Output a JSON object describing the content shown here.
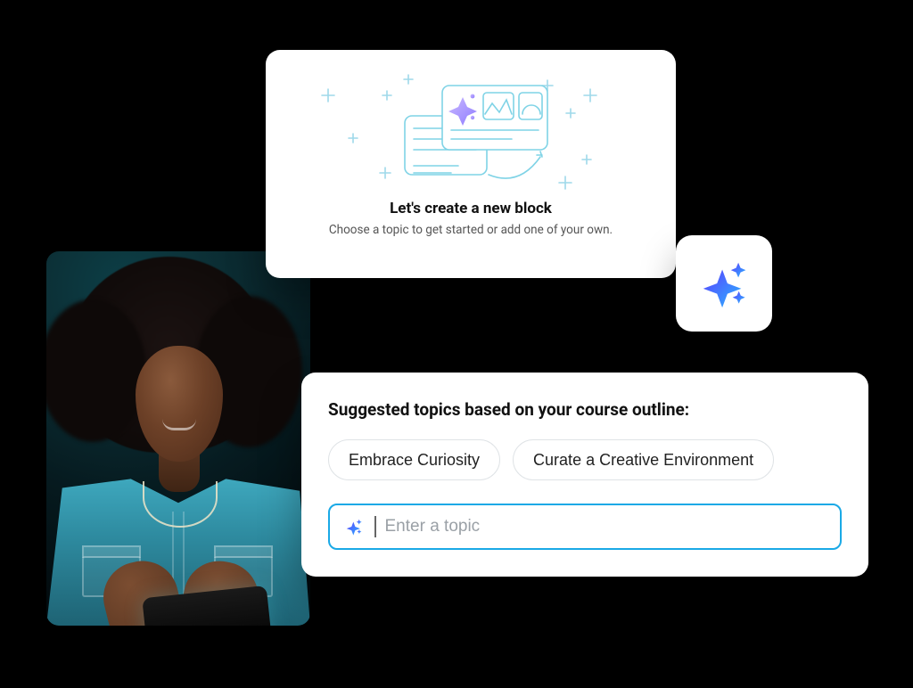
{
  "hero": {
    "title": "Let's create a new block",
    "subtitle": "Choose a topic to get started or add one of your own."
  },
  "suggest": {
    "heading": "Suggested topics based on your course outline:",
    "chips": [
      "Embrace Curiosity",
      "Curate a Creative Environment"
    ],
    "input_placeholder": "Enter a topic",
    "input_value": ""
  },
  "colors": {
    "accent_blue": "#1aa9e6",
    "sparkle_start": "#4b3cff",
    "sparkle_end": "#2bb7ff"
  },
  "icons": {
    "ai_sparkle": "sparkle-icon"
  }
}
